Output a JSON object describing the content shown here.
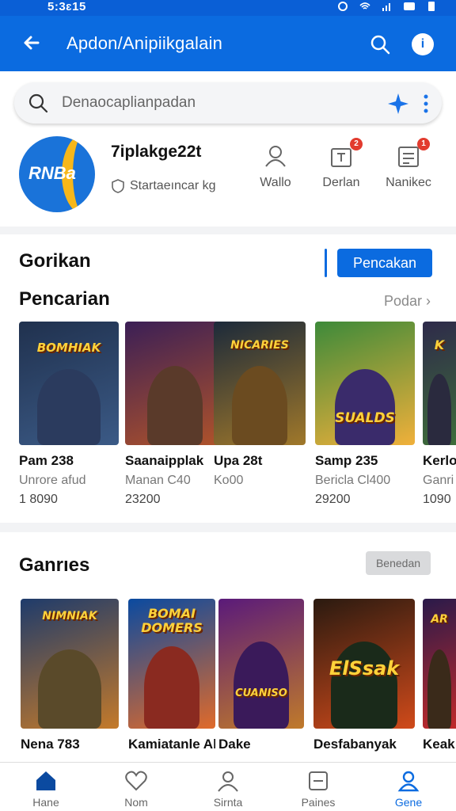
{
  "status_bar": {
    "time": "5:3ԑ15"
  },
  "app_bar": {
    "title": "Apdon/Anipiikgalain"
  },
  "search": {
    "placeholder": "Denaocaplianpadan"
  },
  "app_info": {
    "logo_text": "RNBa",
    "name": "7iplakge22t",
    "subtitle": "Startaeıncar kg",
    "actions": [
      {
        "label": "Wallo",
        "icon": "contacts-icon",
        "badge": ""
      },
      {
        "label": "Derlan",
        "icon": "gift-icon",
        "badge": "2"
      },
      {
        "label": "Nanikec",
        "icon": "notes-icon",
        "badge": "1"
      }
    ]
  },
  "section1": {
    "heading": "Gorikan",
    "button_label": "Pencakan",
    "subheading": "Pencarian",
    "see_all": "Podar ›",
    "cards": [
      {
        "title": "Pam 238",
        "subtitle": "Unrore afud",
        "count": "1 8090",
        "art_text": "BOMHIAK",
        "colors": [
          "#20314e",
          "#3b5a86"
        ],
        "fig": "#2b3b5e"
      },
      {
        "title": "Saanaipplak",
        "subtitle": "Manan C40",
        "count": "23200",
        "art_text": "",
        "colors": [
          "#3b1f56",
          "#b0532a"
        ],
        "fig": "#5a3a2a"
      },
      {
        "title": "Upa 28t",
        "subtitle": "Ko00",
        "count": "",
        "art_text": "NICARIES",
        "colors": [
          "#1c2a3a",
          "#a0782a"
        ],
        "fig": "#6b4b20"
      },
      {
        "title": "Samp 235",
        "subtitle": "Bericla Cl400",
        "count": "29200",
        "art_text": "SUALDS",
        "colors": [
          "#3d8a3a",
          "#f0b03a"
        ],
        "fig": "#3a2b6b"
      },
      {
        "title": "Kerlo",
        "subtitle": "Ganri",
        "count": "1090",
        "art_text": "K",
        "colors": [
          "#2e2a4a",
          "#3e6d3a"
        ],
        "fig": "#2a2a3e"
      }
    ]
  },
  "section2": {
    "heading": "Ganrıes",
    "button_label": "Benedan",
    "cards": [
      {
        "title": "Nena 783",
        "art_text": "NIMNIAK",
        "colors": [
          "#1e3b6b",
          "#c47a2a"
        ],
        "fig": "#5a4a2a"
      },
      {
        "title": "Kamiatanle Al",
        "art_text": "BOMAI DOMERS",
        "colors": [
          "#0a4aa0",
          "#e06a2a"
        ],
        "fig": "#8a2a20"
      },
      {
        "title": "Dake",
        "art_text": "CUANISO",
        "colors": [
          "#5a1a7a",
          "#c07a2a"
        ],
        "fig": "#3a1a5a"
      },
      {
        "title": "Desfabanyak",
        "art_text": "ElSsak",
        "colors": [
          "#2a1a10",
          "#d04a1a"
        ],
        "fig": "#1a2a1a"
      },
      {
        "title": "Keak",
        "art_text": "AR",
        "colors": [
          "#2a1a4a",
          "#c02a2a"
        ],
        "fig": "#3a2a1a"
      }
    ]
  },
  "bottom_nav": [
    {
      "label": "Hane",
      "icon": "home-icon",
      "active": false
    },
    {
      "label": "Nom",
      "icon": "heart-icon",
      "active": false
    },
    {
      "label": "Sirnta",
      "icon": "profile-icon",
      "active": false
    },
    {
      "label": "Paines",
      "icon": "inbox-icon",
      "active": false
    },
    {
      "label": "Gene",
      "icon": "account-icon",
      "active": true
    }
  ],
  "colors": {
    "primary": "#0b6be0",
    "badge": "#e23b2e",
    "accent_gold": "#f7b71a"
  }
}
